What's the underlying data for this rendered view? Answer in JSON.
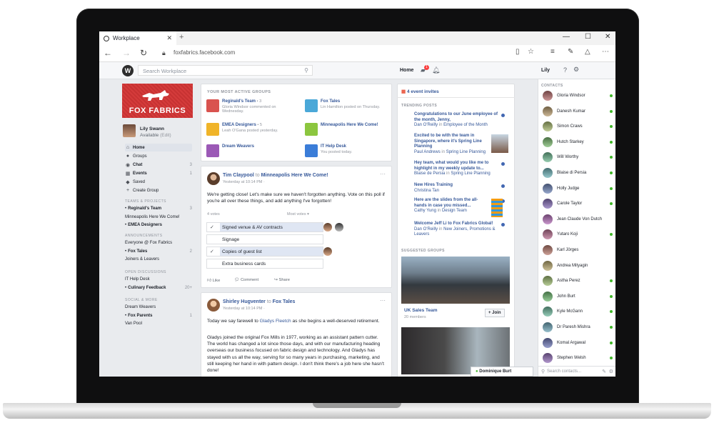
{
  "browser": {
    "tab_title": "Workplace",
    "url": "foxfabrics.facebook.com",
    "new_tab": "+",
    "close": "✕",
    "min": "—",
    "max": "☐"
  },
  "header": {
    "search_placeholder": "Search Workplace",
    "home": "Home",
    "notif_count": "1",
    "user": "Lily"
  },
  "profile": {
    "cover_title": "FOX FABRICS",
    "name": "Lily Swann",
    "status": "Available",
    "edit": "(Edit)"
  },
  "nav": [
    {
      "label": "Home",
      "count": "",
      "icon": "home-icon"
    },
    {
      "label": "Groups",
      "count": "",
      "icon": "groups-icon"
    },
    {
      "label": "Chat",
      "count": "3",
      "icon": "chat-icon"
    },
    {
      "label": "Events",
      "count": "1",
      "icon": "events-icon"
    },
    {
      "label": "Saved",
      "count": "",
      "icon": "saved-icon"
    },
    {
      "label": "Create Group",
      "count": "",
      "icon": "plus-icon"
    }
  ],
  "sections": {
    "teams_head": "TEAMS & PROJECTS",
    "teams": [
      {
        "label": "Reginald's Team",
        "count": "3",
        "bold": true
      },
      {
        "label": "Minneapolis Here We Come!",
        "count": "",
        "bold": false
      },
      {
        "label": "EMEA Designers",
        "count": "",
        "bold": true
      }
    ],
    "ann_head": "ANNOUNCEMENTS",
    "ann": [
      {
        "label": "Everyone @ Fox Fabrics",
        "count": "",
        "bold": false
      },
      {
        "label": "Fox Tales",
        "count": "2",
        "bold": true
      },
      {
        "label": "Joiners & Leavers",
        "count": "",
        "bold": false
      }
    ],
    "disc_head": "OPEN DISCUSSIONS",
    "disc": [
      {
        "label": "IT Help Desk",
        "count": "",
        "bold": false
      },
      {
        "label": "Culinary Feedback",
        "count": "20+",
        "bold": true
      }
    ],
    "social_head": "SOCIAL & MORE",
    "social": [
      {
        "label": "Dream Weavers",
        "count": "",
        "bold": false
      },
      {
        "label": "Fox Parents",
        "count": "1",
        "bold": true
      },
      {
        "label": "Van Pool",
        "count": "",
        "bold": false
      }
    ]
  },
  "active_groups": {
    "title": "YOUR MOST ACTIVE GROUPS",
    "items": [
      {
        "name": "Reginald's Team",
        "extra": " • 3",
        "desc": "Gloria Windsor commented on Wednesday.",
        "color": "#d9534f"
      },
      {
        "name": "Fox Tales",
        "extra": "",
        "desc": "Lin Hamilton posted on Thursday.",
        "color": "#4aa8d8"
      },
      {
        "name": "EMEA Designers",
        "extra": " • 5",
        "desc": "Leah O'Gana posted yesterday.",
        "color": "#f0b429"
      },
      {
        "name": "Minneapolis Here We Come!",
        "extra": "",
        "desc": "",
        "color": "#8cc63f"
      },
      {
        "name": "Dream Weavers",
        "extra": "",
        "desc": "",
        "color": "#9b59b6"
      },
      {
        "name": "IT Help Desk",
        "extra": "",
        "desc": "You posted today.",
        "color": "#3b7dd8"
      }
    ]
  },
  "post1": {
    "author": "Tim Claypool",
    "to": "to",
    "group": "Minneapolis Here We Come!",
    "time": "Yesterday at 10:14 PM ·",
    "text": "We're getting close! Let's make sure we haven't forgotten anything. Vote on this poll if you're all over these things, and add anything I've forgotten!",
    "votes": "4 votes",
    "sort": "Most votes ▾",
    "options": [
      {
        "label": "Signed venue & AV contracts",
        "checked": true
      },
      {
        "label": "Signage",
        "checked": false
      },
      {
        "label": "Copies of guest list",
        "checked": true
      },
      {
        "label": "Extra business cards",
        "checked": false
      }
    ],
    "like": "Like",
    "comment": "Comment",
    "share": "Share",
    "more": "···"
  },
  "post2": {
    "author": "Shirley Hugventer",
    "to": "to",
    "group": "Fox Tales",
    "time": "Yesterday at 10:14 PM ·",
    "p1a": "Today we say farewell to ",
    "p1link": "Gladys Fleetch",
    "p1b": " as she begins a well-deserved retirement.",
    "p2": "Gladys joined the original Fox Mills in 1977, working as an assistant pattern cutter. The world has changed a lot since those days, and with our manufacturing heading overseas our business focused on fabric design and technology. And Gladys has stayed with us all the way, serving for so many years in purchasing, marketing, and still keeping her hand in with pattern design. I don't think there's a job here she hasn't done!",
    "more": "···"
  },
  "right": {
    "invites": "4 event invites",
    "trending_head": "TRENDING POSTS",
    "trending": [
      {
        "title": "Congratulations to our June employee of the month, Jenny,",
        "author": "Dan O'Reilly",
        "in": "in",
        "group": "Employee of the Month"
      },
      {
        "title": "Excited to be with the team in Singapore, where it's Spring Line Planning",
        "author": "Paul Andrews",
        "in": "in",
        "group": "Spring Line Planning"
      },
      {
        "title": "Hey team, what would you like me to highlight in my weekly update to...",
        "author": "Blaise de Persia",
        "in": "in",
        "group": "Spring Line Planning"
      },
      {
        "title": "New Hires Training",
        "author": "Christina Tan",
        "in": "",
        "group": ""
      },
      {
        "title": "Here are the slides from the all-hands in case you missed...",
        "author": "Cathy Yung",
        "in": "in",
        "group": "Design Team"
      },
      {
        "title": "Welcome Jeff Li to Fox Fabrics Global!",
        "author": "Dan O'Reilly",
        "in": "in",
        "group": "New Joiners, Promotions & Leavers"
      }
    ],
    "suggested_head": "SUGGESTED GROUPS",
    "sg_name": "UK Sales Team",
    "sg_members": "20 members",
    "join": "+ Join",
    "chat_name": "Dominique Burt"
  },
  "contacts": {
    "head": "CONTACTS",
    "search": "Search contacts...",
    "list": [
      {
        "name": "Gloria Windsor",
        "online": true
      },
      {
        "name": "Danesh Kumar",
        "online": true
      },
      {
        "name": "Simon Craws",
        "online": true
      },
      {
        "name": "Hutch Starkey",
        "online": true
      },
      {
        "name": "Will Worthy",
        "online": true
      },
      {
        "name": "Blaise di Persia",
        "online": true
      },
      {
        "name": "Holly Judge",
        "online": true
      },
      {
        "name": "Carole Taylor",
        "online": true
      },
      {
        "name": "Jean Claude Von Dutch",
        "online": false
      },
      {
        "name": "Yutaro Koji",
        "online": true
      },
      {
        "name": "Karl Jörges",
        "online": false
      },
      {
        "name": "Andrea Mityagin",
        "online": false
      },
      {
        "name": "Astha Perez",
        "online": true
      },
      {
        "name": "John Burt",
        "online": true
      },
      {
        "name": "Kyle McGann",
        "online": true
      },
      {
        "name": "Dr Paresh Mishra",
        "online": true
      },
      {
        "name": "Komal Argawal",
        "online": true
      },
      {
        "name": "Stephen Welsh",
        "online": true
      }
    ]
  }
}
